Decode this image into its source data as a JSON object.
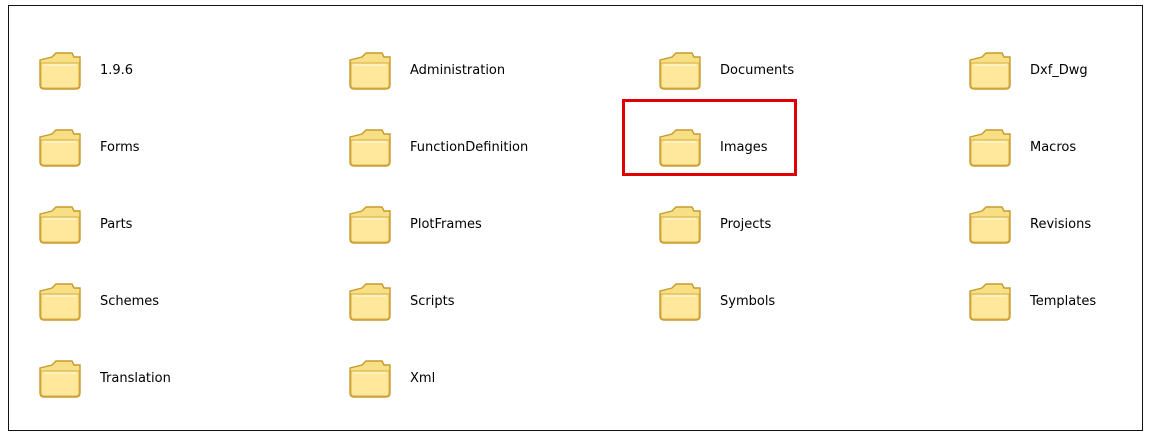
{
  "folders": [
    {
      "label": "1.9.6",
      "icon": "folder-icon"
    },
    {
      "label": "Administration",
      "icon": "folder-icon"
    },
    {
      "label": "Documents",
      "icon": "folder-icon"
    },
    {
      "label": "Dxf_Dwg",
      "icon": "folder-icon"
    },
    {
      "label": "Forms",
      "icon": "folder-icon"
    },
    {
      "label": "FunctionDefinition",
      "icon": "folder-icon"
    },
    {
      "label": "Images",
      "icon": "folder-icon",
      "highlighted": true
    },
    {
      "label": "Macros",
      "icon": "folder-icon"
    },
    {
      "label": "Parts",
      "icon": "folder-icon"
    },
    {
      "label": "PlotFrames",
      "icon": "folder-icon"
    },
    {
      "label": "Projects",
      "icon": "folder-icon"
    },
    {
      "label": "Revisions",
      "icon": "folder-icon"
    },
    {
      "label": "Schemes",
      "icon": "folder-icon"
    },
    {
      "label": "Scripts",
      "icon": "folder-icon"
    },
    {
      "label": "Symbols",
      "icon": "folder-icon"
    },
    {
      "label": "Templates",
      "icon": "folder-icon"
    },
    {
      "label": "Translation",
      "icon": "folder-icon"
    },
    {
      "label": "Xml",
      "icon": "folder-icon"
    }
  ],
  "colors": {
    "highlight": "#e00000",
    "folder_fill": "#f7df86",
    "folder_outline": "#c79a2b"
  }
}
